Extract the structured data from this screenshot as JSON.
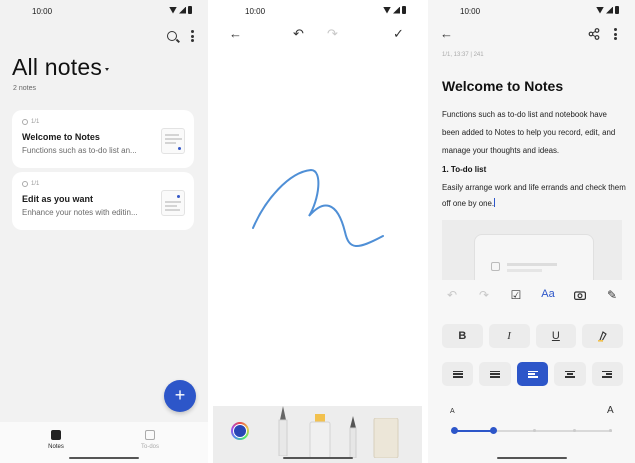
{
  "status": {
    "time": "10:00"
  },
  "notes_list": {
    "title": "All notes",
    "count_text": "2 notes",
    "notes": [
      {
        "meta": "1/1",
        "title": "Welcome to Notes",
        "snippet": "Functions such as to-do list an..."
      },
      {
        "meta": "1/1",
        "title": "Edit as you want",
        "snippet": "Enhance your notes with editin..."
      }
    ],
    "fab_label": "+",
    "nav": {
      "notes_label": "Notes",
      "todo_label": "To-dos"
    }
  },
  "drawing": {
    "toolbar": {
      "back": "←",
      "undo": "↶",
      "redo": "↷",
      "done": "✓"
    },
    "stroke_color": "#4f8fd6",
    "selected_color": "#2846b5",
    "tools": [
      "pen-tool",
      "marker-tool",
      "pencil-tool",
      "eraser-tool"
    ]
  },
  "editor": {
    "toolbar": {
      "back": "←",
      "share": "share-icon",
      "more": "more-icon"
    },
    "meta": "1/1, 13:37  |  241",
    "title": "Welcome to Notes",
    "body": "Functions such as to-do list and notebook have been added to Notes to help you record, edit, and manage your thoughts and ideas.",
    "section_heading": "1. To-do list",
    "section_body": "Easily arrange work and life errands and check them off one by one.",
    "format_icons": {
      "undo": "↶",
      "redo": "↷",
      "check": "☑",
      "text": "Aa",
      "camera": "camera-icon",
      "draw": "✎"
    },
    "style_buttons": {
      "bold": "B",
      "italic": "I",
      "underline": "U",
      "highlight": "highlight"
    },
    "align_buttons": [
      "numbered-list",
      "bulleted-list",
      "align-left",
      "align-center",
      "align-right"
    ],
    "font_size": {
      "small_label": "A",
      "large_label": "A",
      "level": 0.25
    },
    "accent_color": "#2d56c9"
  }
}
